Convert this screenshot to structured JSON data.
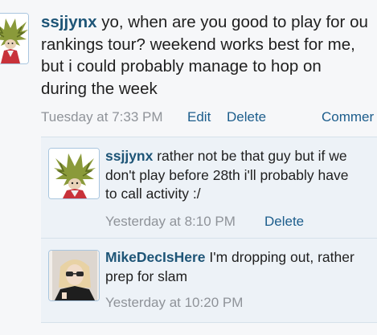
{
  "post": {
    "username": "ssjjynx",
    "lines": [
      "yo, when are you good to play for ou",
      "rankings tour? weekend works best for me,",
      "but i could probably manage to hop on",
      "during the week"
    ],
    "timestamp": "Tuesday at 7:33 PM",
    "edit_label": "Edit",
    "delete_label": "Delete",
    "comment_label": "Commer"
  },
  "replies": [
    {
      "username": "ssjjynx",
      "lines": [
        "rather not be that guy but if we",
        "don't play before 28th i'll probably have",
        "to call activity :/"
      ],
      "timestamp": "Yesterday at 8:10 PM",
      "delete_label": "Delete"
    },
    {
      "username": "MikeDecIsHere",
      "lines": [
        "I'm dropping out, rather",
        "prep for slam"
      ],
      "timestamp": "Yesterday at 10:20 PM"
    }
  ],
  "colors": {
    "username": "#1e5577",
    "link": "#1c5d8c",
    "timestamp": "#8f9399",
    "reply_bg": "#edf2f7"
  }
}
